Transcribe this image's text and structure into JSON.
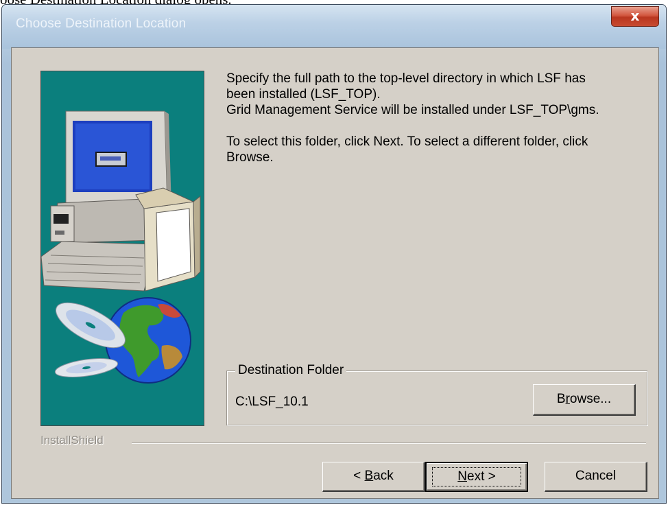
{
  "document": {
    "caption": "oose Destination Location dialog opens."
  },
  "window": {
    "title": "Choose Destination Location",
    "close_glyph": "x"
  },
  "content": {
    "paragraph1_line1": "Specify the full path to the top-level directory in which LSF has",
    "paragraph1_line2": "been installed (LSF_TOP).",
    "paragraph1_line3": "Grid Management Service will be installed under LSF_TOP\\gms.",
    "paragraph2_line1": "To select this folder, click Next. To select a different folder, click",
    "paragraph2_line2": "Browse."
  },
  "destination": {
    "legend": "Destination Folder",
    "path": "C:\\LSF_10.1",
    "browse_prefix": "B",
    "browse_mnemonic": "r",
    "browse_suffix": "owse..."
  },
  "footer": {
    "brand": "InstallShield",
    "back_prefix": "< ",
    "back_mnemonic": "B",
    "back_suffix": "ack",
    "next_mnemonic": "N",
    "next_suffix": "ext >",
    "cancel_label": "Cancel"
  },
  "icons": {
    "close": "close-icon",
    "computer": "computer-illustration",
    "globe": "globe-illustration",
    "discs": "cd-disc-illustration"
  },
  "colors": {
    "dialog_face": "#d5d0c8",
    "side_panel": "#0b7f7d",
    "close_button": "#c74a30",
    "titlebar": "#b7cde2"
  }
}
